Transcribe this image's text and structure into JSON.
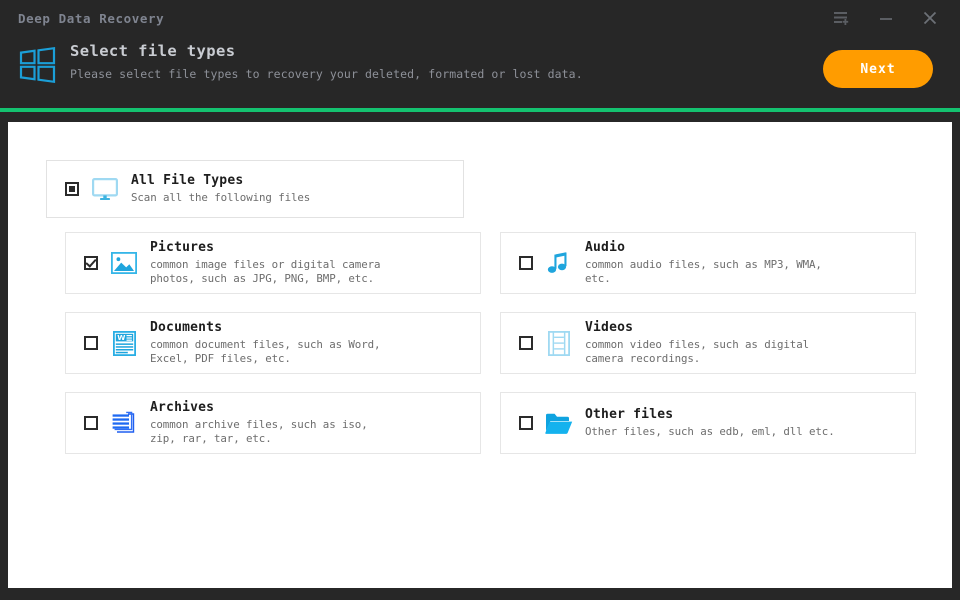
{
  "window": {
    "app_title": "Deep Data Recovery",
    "controls": [
      {
        "name": "menu-button",
        "icon": "menu-plus-icon"
      },
      {
        "name": "minimize-button",
        "icon": "minimize-icon"
      },
      {
        "name": "close-button",
        "icon": "close-icon"
      }
    ]
  },
  "header": {
    "brand_icon": "windows-squares-icon",
    "title": "Select file types",
    "subtitle": "Please select file types to recovery your deleted, formated or lost data.",
    "next_label": "Next"
  },
  "colors": {
    "window_bg": "#272727",
    "panel_bg": "#ffffff",
    "accent_green": "#14c270",
    "accent_orange": "#ff9c00",
    "icon_blue": "#00a0e0",
    "icon_light_blue": "#9fd9f2",
    "title_gray": "#7f8490"
  },
  "all_file_types": {
    "title": "All File Types",
    "description": "Scan all the following files",
    "checkbox_state": "indeterminate",
    "icon": "monitor-icon"
  },
  "file_types": [
    {
      "id": "pictures",
      "title": "Pictures",
      "description": "common image files or digital camera\nphotos, such as JPG, PNG, BMP, etc.",
      "checkbox_state": "checked",
      "icon": "picture-icon"
    },
    {
      "id": "audio",
      "title": "Audio",
      "description": "common audio files, such as MP3, WMA,\netc.",
      "checkbox_state": "unchecked",
      "icon": "music-note-icon"
    },
    {
      "id": "documents",
      "title": "Documents",
      "description": "common document files, such as Word,\nExcel, PDF files, etc.",
      "checkbox_state": "unchecked",
      "icon": "word-document-icon"
    },
    {
      "id": "videos",
      "title": "Videos",
      "description": "common video files, such as digital\ncamera recordings.",
      "checkbox_state": "unchecked",
      "icon": "film-strip-icon"
    },
    {
      "id": "archives",
      "title": "Archives",
      "description": "common archive files, such as iso,\nzip, rar, tar, etc.",
      "checkbox_state": "unchecked",
      "icon": "archive-stack-icon"
    },
    {
      "id": "other",
      "title": "Other files",
      "description": "Other files, such as edb, eml, dll etc.",
      "checkbox_state": "unchecked",
      "icon": "folder-icon"
    }
  ]
}
